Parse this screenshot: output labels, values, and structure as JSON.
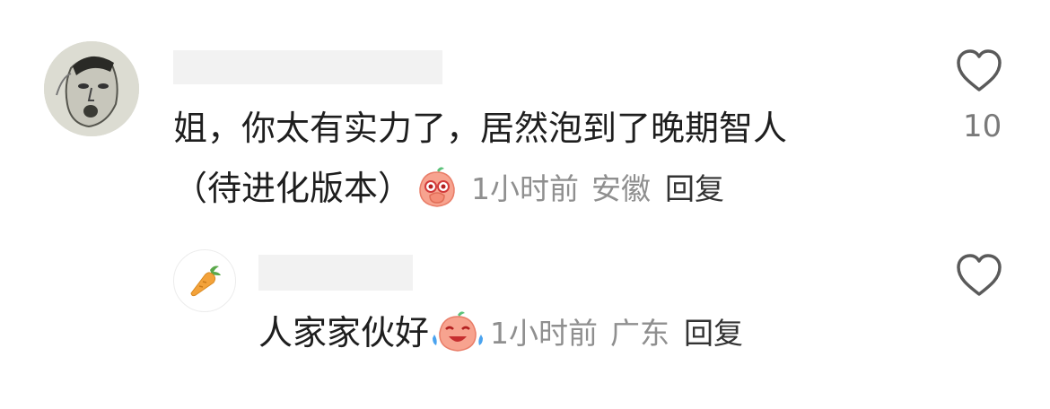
{
  "comments": [
    {
      "text_line1": "姐，你太有实力了，居然泡到了晚期智人",
      "text_line2": "（待进化版本）",
      "emoji": "peach-face-hand-over-mouth",
      "time": "1小时前",
      "location": "安徽",
      "reply_label": "回复",
      "like_count": "10",
      "avatar_icon": "sketch-face-avatar"
    },
    {
      "text": "人家家伙好",
      "emoji": "peach-face-crying-laughing",
      "time": "1小时前",
      "location": "广东",
      "reply_label": "回复",
      "avatar_icon": "carrot-icon"
    }
  ],
  "icons": {
    "like": "heart-outline-icon"
  },
  "colors": {
    "text": "#1e1e1e",
    "meta": "#8f8f8f",
    "placeholder": "#f2f2f2"
  }
}
